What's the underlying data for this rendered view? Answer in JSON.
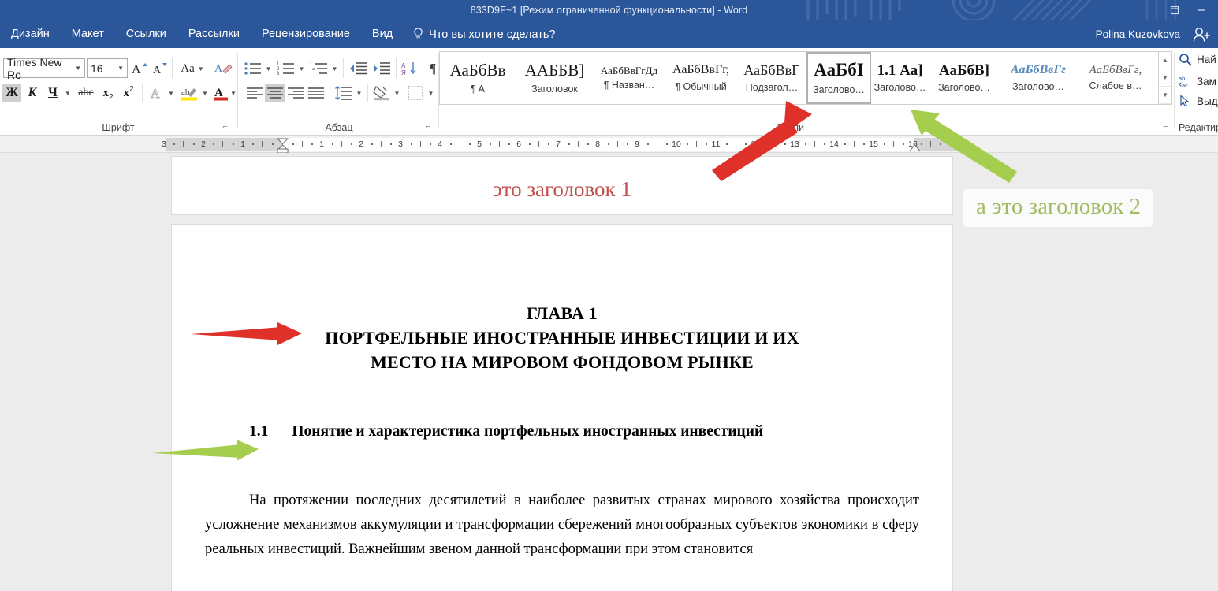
{
  "window": {
    "title": "833D9F~1 [Режим ограниченной функциональности] - Word",
    "restore_icon": "restore-window-icon",
    "minimize_icon": "minimize-window-icon",
    "accent_color": "#2b579a"
  },
  "tabs": [
    {
      "label": "Дизайн",
      "name": "tab-design"
    },
    {
      "label": "Макет",
      "name": "tab-layout"
    },
    {
      "label": "Ссылки",
      "name": "tab-references"
    },
    {
      "label": "Рассылки",
      "name": "tab-mailings"
    },
    {
      "label": "Рецензирование",
      "name": "tab-review"
    },
    {
      "label": "Вид",
      "name": "tab-view"
    }
  ],
  "tell_me": {
    "label": "Что вы хотите сделать?",
    "icon": "lightbulb-icon"
  },
  "account": {
    "name": "Polina Kuzovkova",
    "icon": "add-user-icon"
  },
  "ribbon": {
    "font_group": {
      "label": "Шрифт",
      "font_name": "Times New Ro",
      "font_size": "16",
      "buttons": [
        {
          "glyph": "A",
          "name": "grow-font-button"
        },
        {
          "glyph": "A",
          "name": "shrink-font-button"
        },
        {
          "glyph": "Aa",
          "name": "change-case-button"
        },
        {
          "glyph": "A",
          "name": "clear-formatting-button"
        },
        {
          "glyph": "Ж",
          "name": "bold-button",
          "active": true
        },
        {
          "glyph": "К",
          "name": "italic-button"
        },
        {
          "glyph": "Ч",
          "name": "underline-button"
        },
        {
          "glyph": "abc",
          "name": "strikethrough-button"
        },
        {
          "glyph": "x",
          "name": "subscript-button"
        },
        {
          "glyph": "x",
          "name": "superscript-button"
        },
        {
          "glyph": "A",
          "name": "text-effects-button"
        },
        {
          "glyph": "ab",
          "name": "text-highlight-color-button"
        },
        {
          "glyph": "A",
          "name": "font-color-button"
        }
      ]
    },
    "paragraph_group": {
      "label": "Абзац",
      "buttons": [
        {
          "name": "bullets-button"
        },
        {
          "name": "numbering-button"
        },
        {
          "name": "multilevel-list-button"
        },
        {
          "name": "decrease-indent-button"
        },
        {
          "name": "increase-indent-button"
        },
        {
          "name": "sort-button"
        },
        {
          "name": "show-formatting-marks-button"
        },
        {
          "name": "align-left-button"
        },
        {
          "name": "align-center-button",
          "active": true
        },
        {
          "name": "align-right-button"
        },
        {
          "name": "justify-button"
        },
        {
          "name": "line-spacing-button"
        },
        {
          "name": "shading-button"
        },
        {
          "name": "borders-button"
        }
      ]
    },
    "styles_group": {
      "label": "Стили",
      "items": [
        {
          "preview": "АаБбВв",
          "name": "¶ A",
          "size": 21,
          "weight": "normal",
          "italic": false,
          "color": "#1a1a1a"
        },
        {
          "preview": "ААББВ]",
          "name": "Заголовок",
          "size": 21,
          "weight": "normal",
          "italic": false,
          "color": "#1a1a1a"
        },
        {
          "preview": "АаБбВвГгДд",
          "name": "¶ Назван…",
          "size": 13,
          "weight": "normal",
          "italic": false,
          "color": "#1a1a1a"
        },
        {
          "preview": "АаБбВвГг,",
          "name": "¶ Обычный",
          "size": 16,
          "weight": "normal",
          "italic": false,
          "color": "#1a1a1a"
        },
        {
          "preview": "АаБбВвГ",
          "name": "Подзагол…",
          "size": 18,
          "weight": "normal",
          "italic": false,
          "color": "#1a1a1a"
        },
        {
          "preview": "АаБбІ",
          "name": "Заголово…",
          "size": 23,
          "weight": "bold",
          "italic": false,
          "color": "#111111",
          "selected": true
        },
        {
          "preview": "1.1 Аа]",
          "name": "Заголово…",
          "size": 19,
          "weight": "bold",
          "italic": false,
          "color": "#111111"
        },
        {
          "preview": "АаБбВ]",
          "name": "Заголово…",
          "size": 19,
          "weight": "bold",
          "italic": false,
          "color": "#111111"
        },
        {
          "preview": "АаБбВвГг",
          "name": "Заголово…",
          "size": 16,
          "weight": "bold",
          "italic": true,
          "color": "#5a8bbd"
        },
        {
          "preview": "АаБбВвГг,",
          "name": "Слабое в…",
          "size": 15,
          "weight": "normal",
          "italic": true,
          "color": "#555555"
        }
      ],
      "scroll": {
        "up": "▲",
        "down": "▼",
        "more": "▼"
      }
    },
    "editing_group": {
      "label": "Редактирование",
      "items": [
        {
          "label": "Най",
          "icon": "search-icon",
          "name": "find-button"
        },
        {
          "label": "Зам",
          "icon": "replace-icon",
          "name": "replace-button"
        },
        {
          "label": "Выд",
          "icon": "select-pointer-icon",
          "name": "select-button"
        }
      ]
    }
  },
  "ruler": {
    "left_ticks": [
      "3",
      "2",
      "1"
    ],
    "right_ticks": [
      "1",
      "2",
      "3",
      "4",
      "5",
      "6",
      "7",
      "8",
      "9",
      "10",
      "11",
      "12",
      "13",
      "14",
      "15",
      "16"
    ],
    "first_line_indent_marker": "first-line-indent-marker",
    "left_indent_marker": "left-indent-marker",
    "right_indent_marker": "right-indent-marker"
  },
  "document": {
    "page1_heading": "это заголовок 1",
    "chapter_line1": "ГЛАВА 1",
    "chapter_line2": "ПОРТФЕЛЬНЫЕ ИНОСТРАННЫЕ ИНВЕСТИЦИИ И ИХ",
    "chapter_line3": "МЕСТО НА МИРОВОМ ФОНДОВОМ РЫНКЕ",
    "section_number": "1.1",
    "section_title": "Понятие и характеристика портфельных иностранных инвестиций",
    "paragraph": "На протяжении последних десятилетий в наиболее развитых странах мирового хозяйства происходит усложнение механизмов аккумуляции и трансформации сбережений многообразных субъектов экономики в сферу реальных инвестиций. Важнейшим звеном данной трансформации при этом становится"
  },
  "annotations": {
    "note_text": "а это заголовок 2",
    "note_color": "#a3bb60",
    "red_color": "#e0302a",
    "green_color": "#a5cd4e",
    "arrows": [
      {
        "name": "red-arrow-to-styles-gallery",
        "color": "#e0302a"
      },
      {
        "name": "green-arrow-to-styles-gallery",
        "color": "#a5cd4e"
      },
      {
        "name": "red-arrow-to-chapter-heading",
        "color": "#e0302a"
      },
      {
        "name": "green-arrow-to-section-heading",
        "color": "#a5cd4e"
      }
    ]
  }
}
